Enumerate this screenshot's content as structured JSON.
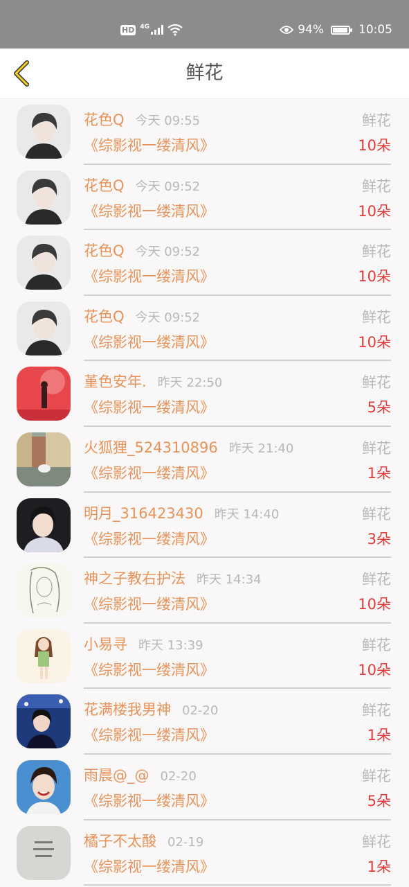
{
  "status_bar": {
    "hd": "HD",
    "network": "4G",
    "battery_percent": "94%",
    "battery_level": 0.94,
    "time": "10:05"
  },
  "header": {
    "title": "鲜花"
  },
  "records": [
    {
      "sender": "花色Q",
      "time": "今天 09:55",
      "type": "鲜花",
      "book": "《综影视一缕清风》",
      "count": "10朵",
      "avatar": "boy-portrait"
    },
    {
      "sender": "花色Q",
      "time": "今天 09:52",
      "type": "鲜花",
      "book": "《综影视一缕清风》",
      "count": "10朵",
      "avatar": "boy-portrait"
    },
    {
      "sender": "花色Q",
      "time": "今天 09:52",
      "type": "鲜花",
      "book": "《综影视一缕清风》",
      "count": "10朵",
      "avatar": "boy-portrait"
    },
    {
      "sender": "花色Q",
      "time": "今天 09:52",
      "type": "鲜花",
      "book": "《综影视一缕清风》",
      "count": "10朵",
      "avatar": "boy-portrait"
    },
    {
      "sender": "堇色安年.",
      "time": "昨天 22:50",
      "type": "鲜花",
      "book": "《综影视一缕清风》",
      "count": "5朵",
      "avatar": "red-scene"
    },
    {
      "sender": "火狐狸_524310896",
      "time": "昨天 21:40",
      "type": "鲜花",
      "book": "《综影视一缕清风》",
      "count": "1朵",
      "avatar": "seagull-town"
    },
    {
      "sender": "明月_316423430",
      "time": "昨天 14:40",
      "type": "鲜花",
      "book": "《综影视一缕清风》",
      "count": "3朵",
      "avatar": "girl-photo"
    },
    {
      "sender": "神之子教右护法",
      "time": "昨天 14:34",
      "type": "鲜花",
      "book": "《综影视一缕清风》",
      "count": "10朵",
      "avatar": "sketch-girl"
    },
    {
      "sender": "小易寻",
      "time": "昨天 13:39",
      "type": "鲜花",
      "book": "《综影视一缕清风》",
      "count": "10朵",
      "avatar": "cartoon-girl"
    },
    {
      "sender": "花满楼我男神",
      "time": "02-20",
      "type": "鲜花",
      "book": "《综影视一缕清风》",
      "count": "1朵",
      "avatar": "tv-stage"
    },
    {
      "sender": "雨晨@_@",
      "time": "02-20",
      "type": "鲜花",
      "book": "《综影视一缕清风》",
      "count": "5朵",
      "avatar": "smiling-boy"
    },
    {
      "sender": "橘子不太酸",
      "time": "02-19",
      "type": "鲜花",
      "book": "《综影视一缕清风》",
      "count": "1朵",
      "avatar": "paper-note"
    }
  ]
}
